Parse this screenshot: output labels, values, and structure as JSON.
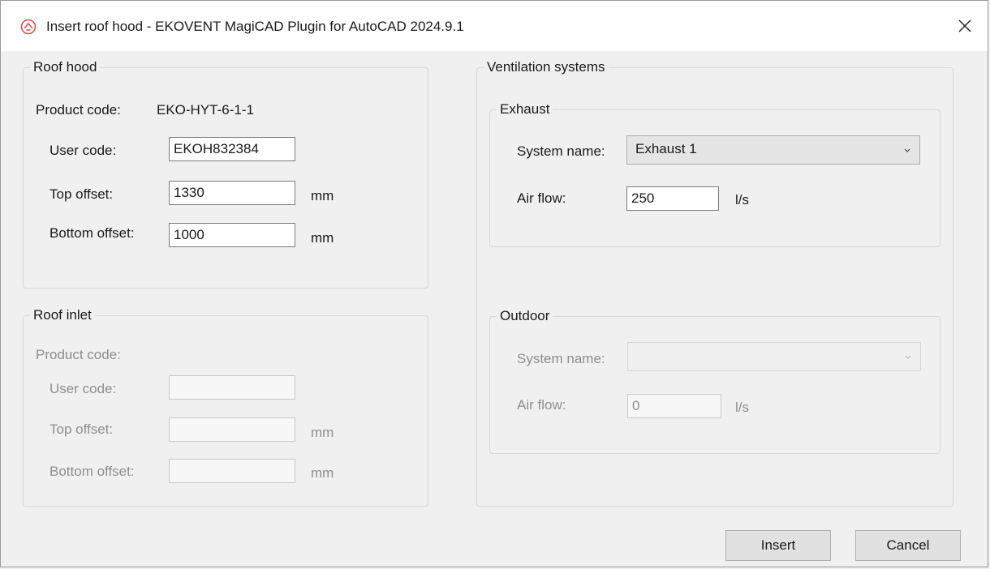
{
  "window": {
    "title": "Insert roof hood - EKOVENT MagiCAD Plugin for AutoCAD 2024.9.1",
    "accent_color": "#d9534f"
  },
  "roof_hood": {
    "legend": "Roof hood",
    "product_code_label": "Product code:",
    "product_code_value": "EKO-HYT-6-1-1",
    "user_code_label": "User code:",
    "user_code_value": "EKOH832384",
    "top_offset_label": "Top offset:",
    "top_offset_value": "1330",
    "top_offset_unit": "mm",
    "bottom_offset_label": "Bottom offset:",
    "bottom_offset_value": "1000",
    "bottom_offset_unit": "mm"
  },
  "roof_inlet": {
    "legend": "Roof inlet",
    "product_code_label": "Product code:",
    "user_code_label": "User code:",
    "user_code_value": "",
    "top_offset_label": "Top offset:",
    "top_offset_value": "",
    "top_offset_unit": "mm",
    "bottom_offset_label": "Bottom offset:",
    "bottom_offset_value": "",
    "bottom_offset_unit": "mm"
  },
  "ventilation": {
    "legend": "Ventilation systems",
    "exhaust": {
      "legend": "Exhaust",
      "system_name_label": "System name:",
      "system_name_value": "Exhaust 1",
      "air_flow_label": "Air flow:",
      "air_flow_value": "250",
      "air_flow_unit": "l/s"
    },
    "outdoor": {
      "legend": "Outdoor",
      "system_name_label": "System name:",
      "system_name_value": "",
      "air_flow_label": "Air flow:",
      "air_flow_value": "0",
      "air_flow_unit": "l/s"
    }
  },
  "buttons": {
    "insert": "Insert",
    "cancel": "Cancel"
  }
}
